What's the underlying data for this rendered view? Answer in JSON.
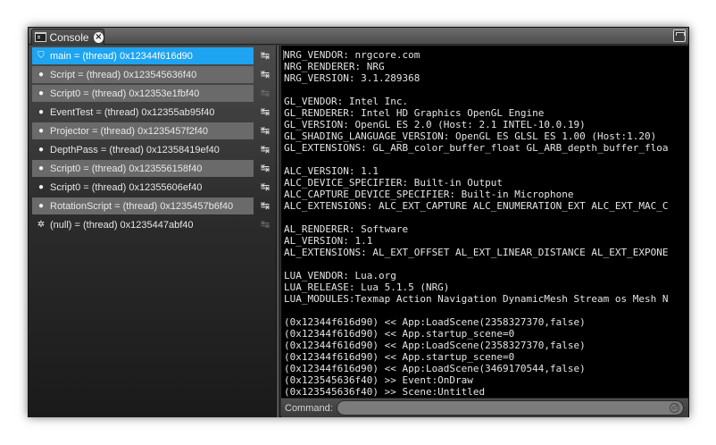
{
  "window": {
    "tab_title": "Console",
    "tab_close": "×"
  },
  "threads": [
    {
      "label": "main = (thread) 0x12344f616d90",
      "icon": "⛉",
      "action_icon": "↹",
      "state": "selected"
    },
    {
      "label": "Script = (thread) 0x123545636f40",
      "icon": "●",
      "action_icon": "↹",
      "state": "shaded"
    },
    {
      "label": "Script0 = (thread) 0x12353e1fbf40",
      "icon": "●",
      "action_icon": "↹",
      "state": "shaded",
      "action_dim": true
    },
    {
      "label": "EventTest = (thread) 0x12355ab95f40",
      "icon": "●",
      "action_icon": "↹",
      "state": "plain"
    },
    {
      "label": "Projector = (thread) 0x1235457f2f40",
      "icon": "●",
      "action_icon": "↹",
      "state": "shaded"
    },
    {
      "label": "DepthPass = (thread) 0x12358419ef40",
      "icon": "●",
      "action_icon": "↹",
      "state": "plain"
    },
    {
      "label": "Script0 = (thread) 0x123556158f40",
      "icon": "●",
      "action_icon": "↹",
      "state": "shaded"
    },
    {
      "label": "Script0 = (thread) 0x12355606ef40",
      "icon": "●",
      "action_icon": "↹",
      "state": "plain"
    },
    {
      "label": "RotationScript = (thread) 0x1235457b6f40",
      "icon": "●",
      "action_icon": "↹",
      "state": "shaded"
    },
    {
      "label": "(null) = (thread) 0x1235447abf40",
      "icon": "✲",
      "action_icon": "↹",
      "state": "plain",
      "action_dim": true
    }
  ],
  "console_lines": [
    "NRG_VENDOR: nrgcore.com",
    "NRG_RENDERER: NRG",
    "NRG_VERSION: 3.1.289368",
    "",
    "GL_VENDOR: Intel Inc.",
    "GL_RENDERER: Intel HD Graphics OpenGL Engine",
    "GL_VERSION: OpenGL ES 2.0 (Host: 2.1 INTEL-10.0.19)",
    "GL_SHADING_LANGUAGE_VERSION: OpenGL ES GLSL ES 1.00 (Host:1.20)",
    "GL_EXTENSIONS: GL_ARB_color_buffer_float GL_ARB_depth_buffer_floa",
    "",
    "ALC_VERSION: 1.1",
    "ALC_DEVICE_SPECIFIER: Built-in Output",
    "ALC_CAPTURE_DEVICE_SPECIFIER: Built-in Microphone",
    "ALC_EXTENSIONS: ALC_EXT_CAPTURE ALC_ENUMERATION_EXT ALC_EXT_MAC_C",
    "",
    "AL_RENDERER: Software",
    "AL_VERSION: 1.1",
    "AL_EXTENSIONS: AL_EXT_OFFSET AL_EXT_LINEAR_DISTANCE AL_EXT_EXPONE",
    "",
    "LUA_VENDOR: Lua.org",
    "LUA_RELEASE: Lua 5.1.5 (NRG)",
    "LUA_MODULES:Texmap Action Navigation DynamicMesh Stream os Mesh N",
    "",
    "(0x12344f616d90) << App:LoadScene(2358327370,false)",
    "(0x12344f616d90) << App.startup_scene=0",
    "(0x12344f616d90) << App:LoadScene(2358327370,false)",
    "(0x12344f616d90) << App.startup_scene=0",
    "(0x12344f616d90) << App:LoadScene(3469170544,false)",
    "(0x123545636f40) >> Event:OnDraw",
    "(0x123545636f40) >> Scene:Untitled"
  ],
  "command": {
    "label": "Command:",
    "value": "",
    "enter_icon": "⏎"
  }
}
